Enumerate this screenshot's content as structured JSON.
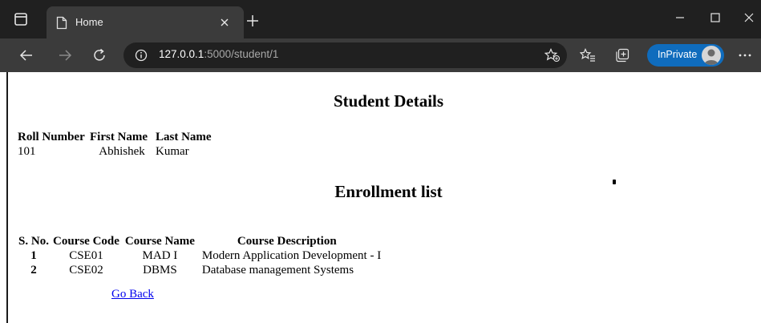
{
  "browser": {
    "tab": {
      "title": "Home"
    },
    "address": {
      "host": "127.0.0.1",
      "path": ":5000/student/1"
    },
    "inprivate_label": "InPrivate",
    "accent_color": "#0f6cbd"
  },
  "page": {
    "student_heading": "Student Details",
    "student_table": {
      "headers": [
        "Roll Number",
        "First Name",
        "Last Name"
      ],
      "row": {
        "roll": "101",
        "first": "Abhishek",
        "last": "Kumar"
      }
    },
    "enrollment_heading": "Enrollment list",
    "enrollment_table": {
      "headers": [
        "S. No.",
        "Course Code",
        "Course Name",
        "Course Description"
      ],
      "rows": [
        {
          "sno": "1",
          "code": "CSE01",
          "name": "MAD I",
          "description": "Modern Application Development - I"
        },
        {
          "sno": "2",
          "code": "CSE02",
          "name": "DBMS",
          "description": "Database management Systems"
        }
      ]
    },
    "go_back_label": "Go Back",
    "link_color": "#0000ee"
  }
}
